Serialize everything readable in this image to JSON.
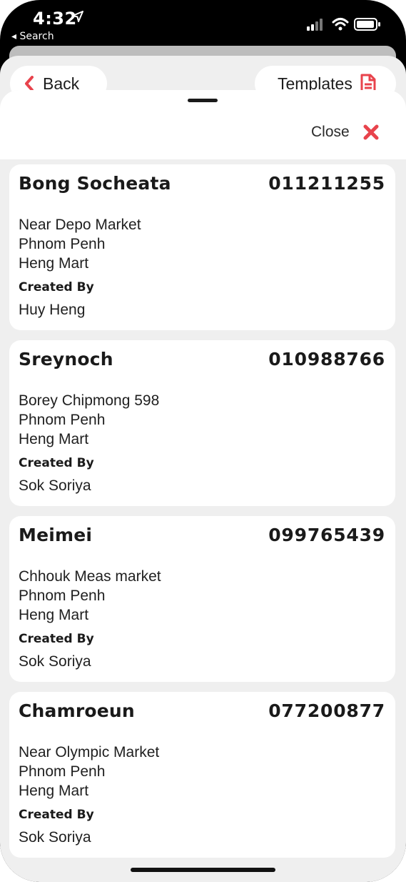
{
  "status_bar": {
    "time": "4:32",
    "back_app": "◂ Search"
  },
  "nav": {
    "back_label": "Back",
    "templates_label": "Templates",
    "accent_color": "#e8434c"
  },
  "modal": {
    "close_label": "Close"
  },
  "customers": [
    {
      "name": "Bong Socheata",
      "phone": "011211255",
      "address": "Near Depo Market",
      "city": "Phnom Penh",
      "store": "Heng Mart",
      "created_by_label": "Created By",
      "created_by": "Huy Heng"
    },
    {
      "name": "Sreynoch",
      "phone": "010988766",
      "address": "Borey Chipmong 598",
      "city": "Phnom Penh",
      "store": "Heng Mart",
      "created_by_label": "Created By",
      "created_by": "Sok Soriya"
    },
    {
      "name": "Meimei",
      "phone": "099765439",
      "address": "Chhouk Meas market",
      "city": "Phnom Penh",
      "store": "Heng Mart",
      "created_by_label": "Created By",
      "created_by": "Sok Soriya"
    },
    {
      "name": "Chamroeun",
      "phone": "077200877",
      "address": "Near Olympic Market",
      "city": "Phnom Penh",
      "store": "Heng Mart",
      "created_by_label": "Created By",
      "created_by": "Sok Soriya"
    }
  ]
}
